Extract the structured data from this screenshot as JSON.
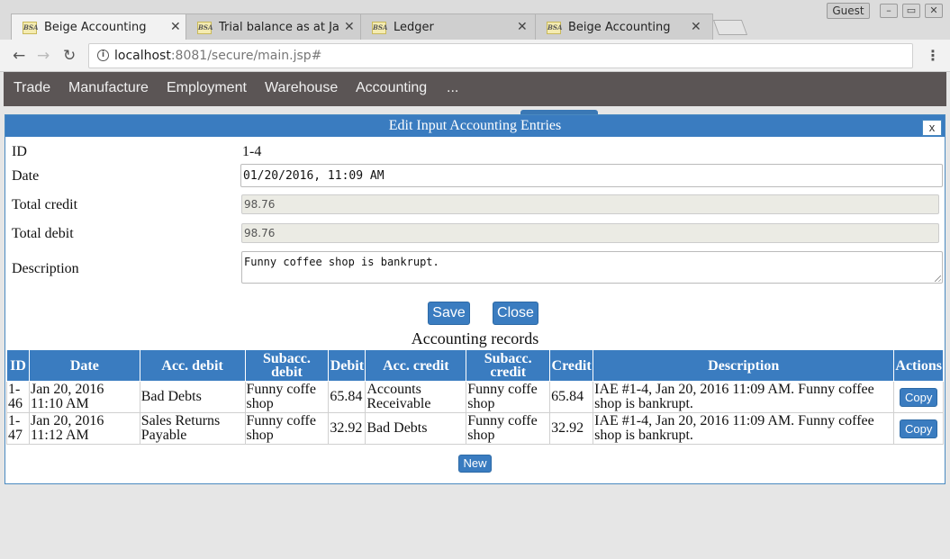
{
  "browser": {
    "tabs": [
      {
        "title": "Beige Accounting",
        "favicon": "BSA",
        "active": true
      },
      {
        "title": "Trial balance as at Ja",
        "favicon": "BSA",
        "active": false
      },
      {
        "title": "Ledger",
        "favicon": "BSA",
        "active": false
      },
      {
        "title": "Beige Accounting",
        "favicon": "BSA",
        "active": false
      }
    ],
    "profile_label": "Guest",
    "url_host": "localhost",
    "url_rest": ":8081/secure/main.jsp#"
  },
  "menu": {
    "items": [
      "Trade",
      "Manufacture",
      "Employment",
      "Warehouse",
      "Accounting",
      "..."
    ]
  },
  "dialog": {
    "title": "Edit Input Accounting Entries",
    "close_label": "x",
    "fields": {
      "id": {
        "label": "ID",
        "value": "1-4"
      },
      "date": {
        "label": "Date",
        "value": "01/20/2016, 11:09 AM"
      },
      "total_credit": {
        "label": "Total credit",
        "value": "98.76"
      },
      "total_debit": {
        "label": "Total debit",
        "value": "98.76"
      },
      "description": {
        "label": "Description",
        "value": "Funny coffee shop is bankrupt."
      }
    },
    "save_label": "Save",
    "close_button_label": "Close",
    "records_title": "Accounting records",
    "columns": [
      "ID",
      "Date",
      "Acc. debit",
      "Subacc. debit",
      "Debit",
      "Acc. credit",
      "Subacc. credit",
      "Credit",
      "Description",
      "Actions"
    ],
    "rows": [
      {
        "id": "1-46",
        "date": "Jan 20, 2016 11:10 AM",
        "acc_debit": "Bad Debts",
        "subacc_debit": "Funny coffe shop",
        "debit": "65.84",
        "acc_credit": "Accounts Receivable",
        "subacc_credit": "Funny coffe shop",
        "credit": "65.84",
        "description": "IAE #1-4, Jan 20, 2016 11:09 AM. Funny coffee shop is bankrupt.",
        "action": "Copy"
      },
      {
        "id": "1-47",
        "date": "Jan 20, 2016 11:12 AM",
        "acc_debit": "Sales Returns Payable",
        "subacc_debit": "Funny coffe shop",
        "debit": "32.92",
        "acc_credit": "Bad Debts",
        "subacc_credit": "Funny coffe shop",
        "credit": "32.92",
        "description": "IAE #1-4, Jan 20, 2016 11:09 AM. Funny coffee shop is bankrupt.",
        "action": "Copy"
      }
    ],
    "new_label": "New"
  }
}
